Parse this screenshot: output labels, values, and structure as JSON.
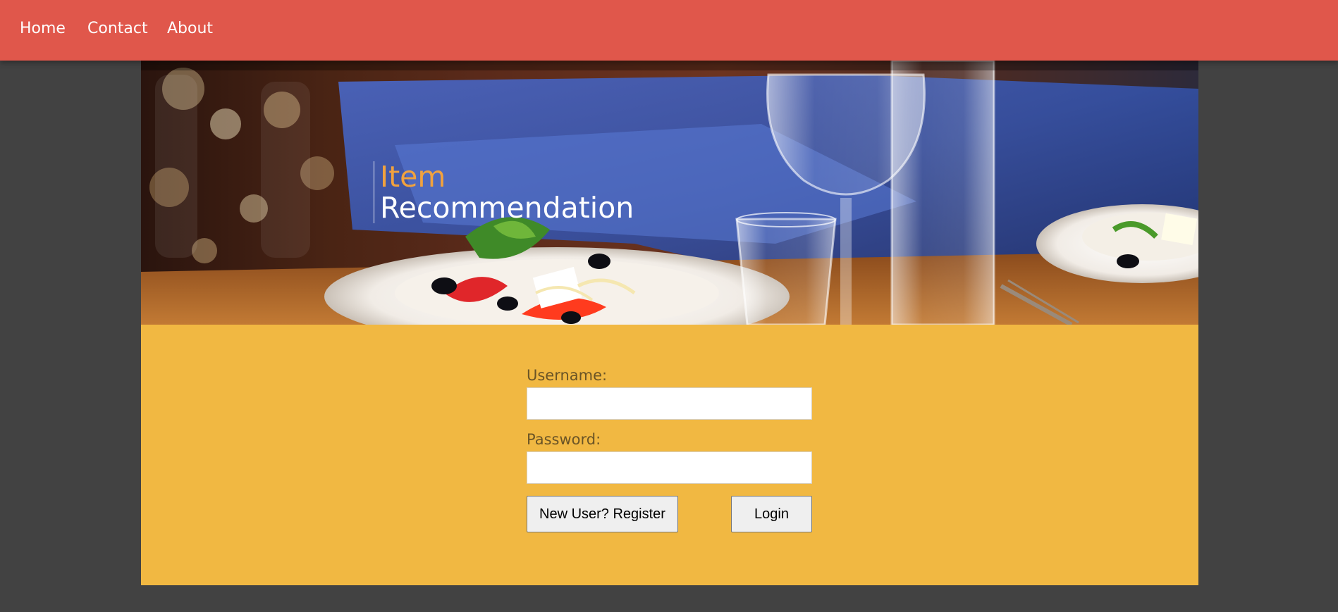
{
  "nav": {
    "items": [
      {
        "label": "Home"
      },
      {
        "label": "Contact"
      },
      {
        "label": "About"
      }
    ]
  },
  "banner": {
    "title_accent": "Item",
    "title_main": "Recommendation",
    "image_description_icon": "restaurant-table-photo"
  },
  "login_form": {
    "username_label": "Username:",
    "username_value": "",
    "password_label": "Password:",
    "password_value": "",
    "register_button": "New User? Register",
    "login_button": "Login"
  },
  "colors": {
    "nav_background": "#e0574b",
    "page_background": "#424242",
    "form_background": "#f1b842",
    "title_accent": "#f1a23e"
  }
}
